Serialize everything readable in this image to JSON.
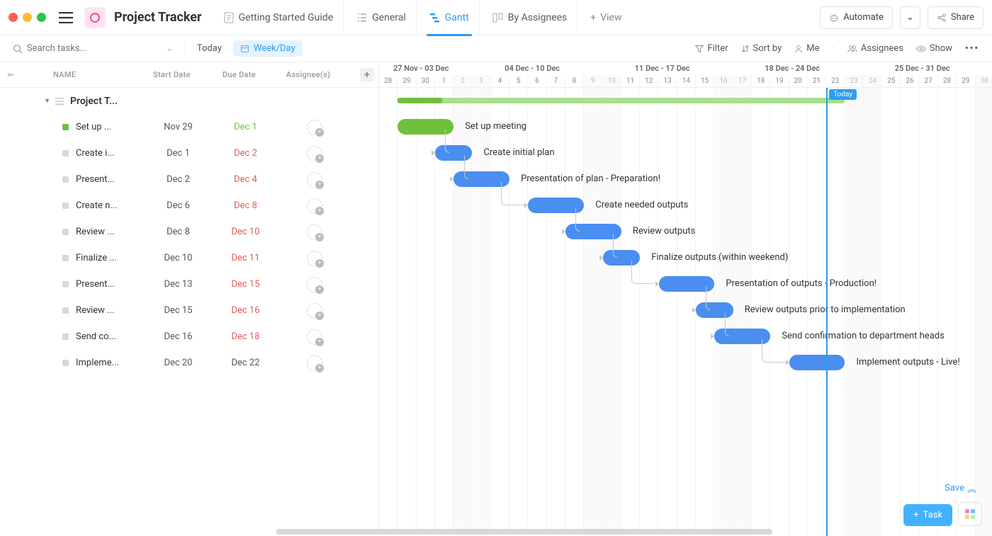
{
  "header": {
    "project_name": "Project Tracker",
    "tabs": [
      {
        "label": "Getting Started Guide",
        "icon": "doc-list-icon"
      },
      {
        "label": "General",
        "icon": "list-icon"
      },
      {
        "label": "Gantt",
        "icon": "gantt-icon",
        "active": true
      },
      {
        "label": "By Assignees",
        "icon": "board-icon"
      }
    ],
    "add_view_label": "View",
    "automate_label": "Automate",
    "share_label": "Share"
  },
  "toolbar": {
    "search_placeholder": "Search tasks...",
    "today_label": "Today",
    "zoom_label": "Week/Day",
    "filter_label": "Filter",
    "sortby_label": "Sort by",
    "me_label": "Me",
    "assignees_label": "Assignees",
    "show_label": "Show"
  },
  "columns": {
    "name": "NAME",
    "start": "Start Date",
    "due": "Due Date",
    "assignee": "Assignee(s)"
  },
  "group": {
    "name": "Project T..."
  },
  "tasks": [
    {
      "name": "Set up ...",
      "full": "Set up meeting",
      "start": "Nov 29",
      "due": "Dec 1",
      "due_color": "#6fc03d",
      "status": "#6fc03d",
      "bar_color": "green",
      "bar_start": 1,
      "bar_end": 4
    },
    {
      "name": "Create i...",
      "full": "Create initial plan",
      "start": "Dec 1",
      "due": "Dec 2",
      "due_color": "#e05b5b",
      "status": "#d8d8d8",
      "bar_color": "blue",
      "bar_start": 3,
      "bar_end": 5
    },
    {
      "name": "Present...",
      "full": "Presentation of plan - Preparation!",
      "start": "Dec 2",
      "due": "Dec 4",
      "due_color": "#e05b5b",
      "status": "#d8d8d8",
      "bar_color": "blue",
      "bar_start": 4,
      "bar_end": 7
    },
    {
      "name": "Create n...",
      "full": "Create needed outputs",
      "start": "Dec 6",
      "due": "Dec 8",
      "due_color": "#e05b5b",
      "status": "#d8d8d8",
      "bar_color": "blue",
      "bar_start": 8,
      "bar_end": 11
    },
    {
      "name": "Review ...",
      "full": "Review outputs",
      "start": "Dec 8",
      "due": "Dec 10",
      "due_color": "#e05b5b",
      "status": "#d8d8d8",
      "bar_color": "blue",
      "bar_start": 10,
      "bar_end": 13
    },
    {
      "name": "Finalize ...",
      "full": "Finalize outputs (within weekend)",
      "start": "Dec 10",
      "due": "Dec 11",
      "due_color": "#e05b5b",
      "status": "#d8d8d8",
      "bar_color": "blue",
      "bar_start": 12,
      "bar_end": 14
    },
    {
      "name": "Present...",
      "full": "Presentation of outputs - Production!",
      "start": "Dec 13",
      "due": "Dec 15",
      "due_color": "#e05b5b",
      "status": "#d8d8d8",
      "bar_color": "blue",
      "bar_start": 15,
      "bar_end": 18
    },
    {
      "name": "Review ...",
      "full": "Review outputs prior to implementation",
      "start": "Dec 15",
      "due": "Dec 16",
      "due_color": "#e05b5b",
      "status": "#d8d8d8",
      "bar_color": "blue",
      "bar_start": 17,
      "bar_end": 19
    },
    {
      "name": "Send co...",
      "full": "Send confirmation to department heads",
      "start": "Dec 16",
      "due": "Dec 18",
      "due_color": "#e05b5b",
      "status": "#d8d8d8",
      "bar_color": "blue",
      "bar_start": 18,
      "bar_end": 21
    },
    {
      "name": "Impleme...",
      "full": "Implement outputs - Live!",
      "start": "Dec 20",
      "due": "Dec 22",
      "due_color": "#555",
      "status": "#d8d8d8",
      "bar_color": "blue",
      "bar_start": 22,
      "bar_end": 25
    }
  ],
  "timeline": {
    "weeks": [
      {
        "label": "27 Nov - 03 Dec",
        "span": 6
      },
      {
        "label": "04 Dec - 10 Dec",
        "span": 7
      },
      {
        "label": "11 Dec - 17 Dec",
        "span": 7
      },
      {
        "label": "18 Dec - 24 Dec",
        "span": 7
      },
      {
        "label": "25 Dec - 31 Dec",
        "span": 6
      }
    ],
    "days": [
      {
        "n": "28",
        "we": false
      },
      {
        "n": "29",
        "we": false
      },
      {
        "n": "30",
        "we": false
      },
      {
        "n": "1",
        "we": false
      },
      {
        "n": "2",
        "we": true
      },
      {
        "n": "3",
        "we": true
      },
      {
        "n": "4",
        "we": false
      },
      {
        "n": "5",
        "we": false
      },
      {
        "n": "6",
        "we": false
      },
      {
        "n": "7",
        "we": false
      },
      {
        "n": "8",
        "we": false
      },
      {
        "n": "9",
        "we": true
      },
      {
        "n": "10",
        "we": true
      },
      {
        "n": "11",
        "we": false
      },
      {
        "n": "12",
        "we": false
      },
      {
        "n": "13",
        "we": false
      },
      {
        "n": "14",
        "we": false
      },
      {
        "n": "15",
        "we": false
      },
      {
        "n": "16",
        "we": true
      },
      {
        "n": "17",
        "we": true
      },
      {
        "n": "18",
        "we": false
      },
      {
        "n": "19",
        "we": false
      },
      {
        "n": "20",
        "we": false
      },
      {
        "n": "21",
        "we": false
      },
      {
        "n": "22",
        "we": false
      },
      {
        "n": "23",
        "we": true
      },
      {
        "n": "24",
        "we": true
      },
      {
        "n": "25",
        "we": false
      },
      {
        "n": "26",
        "we": false
      },
      {
        "n": "27",
        "we": false
      },
      {
        "n": "28",
        "we": false
      },
      {
        "n": "29",
        "we": false
      },
      {
        "n": "30",
        "we": true
      }
    ],
    "today_label": "Today",
    "today_index": 24,
    "summary_start": 1,
    "summary_end": 25,
    "summary_progress": 0.1
  },
  "footer": {
    "save_label": "Save",
    "task_btn_label": "Task"
  },
  "colors": {
    "accent": "#2c9cf2",
    "blue_bar": "#4a8ef0",
    "green_bar": "#6fc03d",
    "due_overdue": "#e05b5b"
  }
}
